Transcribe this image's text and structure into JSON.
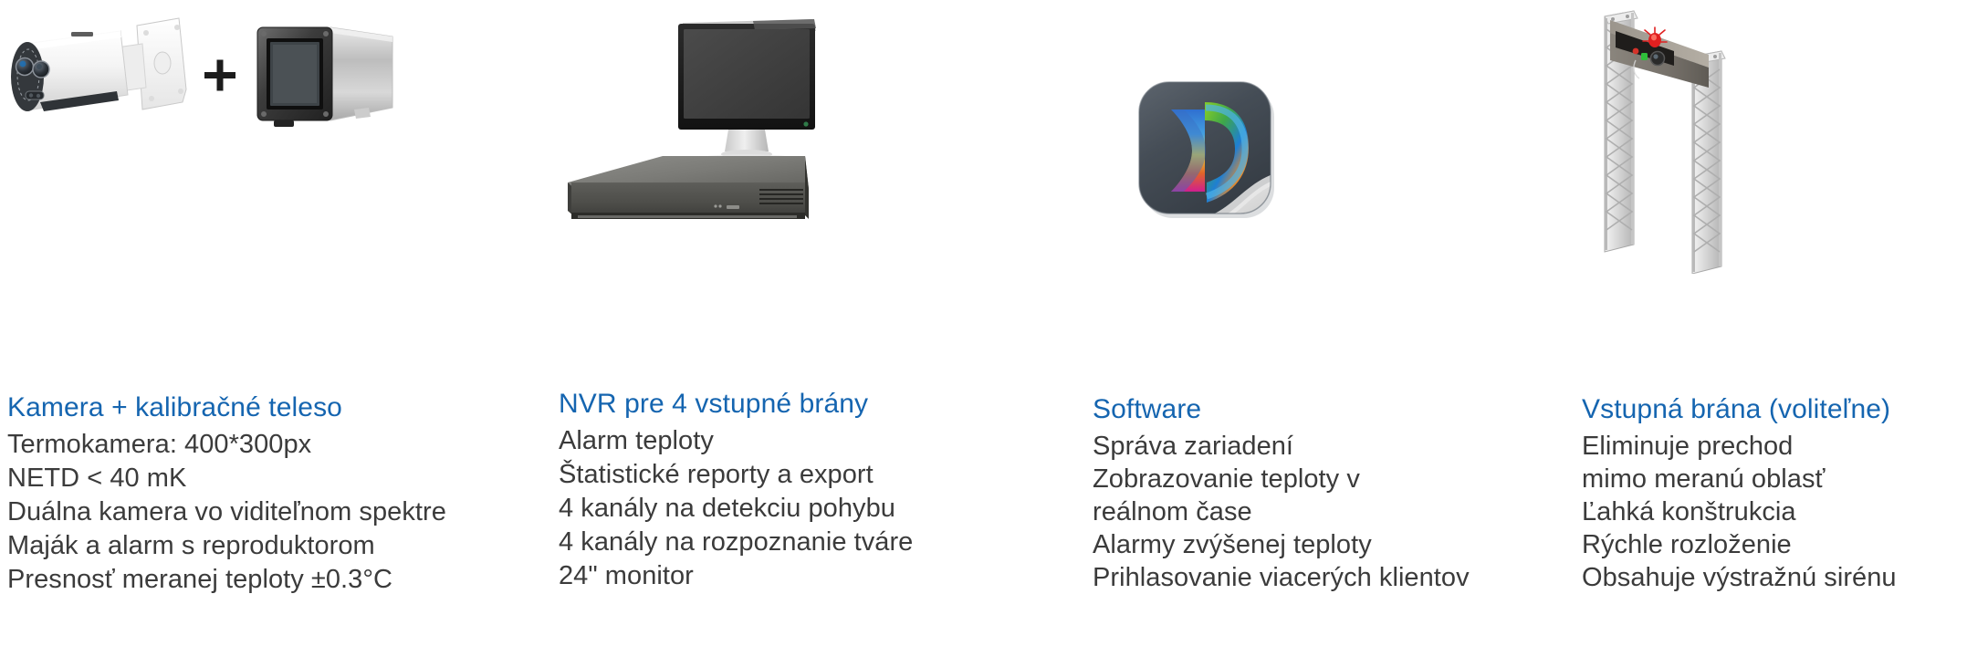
{
  "theme": {
    "background": "#ffffff",
    "heading_color": "#1565b0",
    "body_color": "#3b3b3b"
  },
  "columns": [
    {
      "id": "kamera",
      "artwork": "thermal-bullet-camera-plus-blackbody",
      "plus_sign": "+",
      "heading": "Kamera + kalibračné teleso",
      "features": [
        "Termokamera: 400*300px",
        "NETD < 40 mK",
        "Duálna kamera vo viditeľnom spektre",
        "Maják a alarm s reproduktorom",
        "Presnosť meranej teploty ±0.3°C"
      ]
    },
    {
      "id": "nvr",
      "artwork": "nvr-recorder-with-monitor",
      "heading": "NVR pre 4 vstupné brány",
      "features": [
        "Alarm teploty",
        "Štatistické reporty a export",
        "4 kanály na detekciu pohybu",
        "4 kanály na rozpoznanie tváre",
        "24\" monitor"
      ]
    },
    {
      "id": "software",
      "artwork": "software-app-icon",
      "heading": "Software",
      "features": [
        "Správa zariadení",
        "Zobrazovanie teploty v reálnom čase",
        "Alarmy zvýšenej teploty",
        "Prihlasovanie viacerých klientov"
      ]
    },
    {
      "id": "vstupna-brana",
      "artwork": "truss-entrance-gate-with-siren",
      "heading": "Vstupná brána (voliteľne)",
      "features": [
        "Eliminuje prechod mimo meranú oblasť",
        "Ľahká konštrukcia",
        "Rýchle rozloženie",
        "Obsahuje výstražnú sirénu"
      ]
    }
  ]
}
